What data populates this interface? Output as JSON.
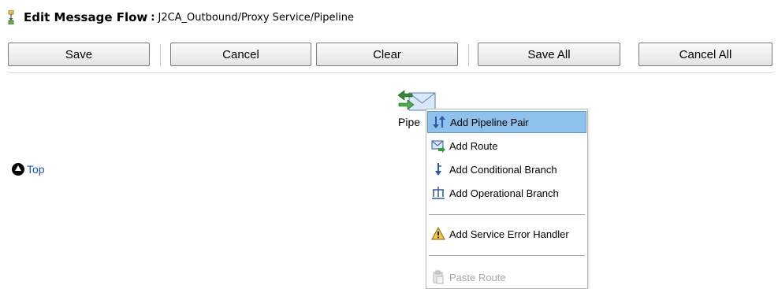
{
  "header": {
    "title": "Edit Message Flow",
    "separator": ":",
    "path": "J2CA_Outbound/Proxy Service/Pipeline"
  },
  "toolbar": {
    "save_label": "Save",
    "cancel_label": "Cancel",
    "clear_label": "Clear",
    "save_all_label": "Save All",
    "cancel_all_label": "Cancel All"
  },
  "flow": {
    "node_label": "Pipe",
    "node_icon": "pipeline-envelope-icon"
  },
  "nav": {
    "top_label": "Top",
    "top_icon": "up-arrow-circle-icon"
  },
  "context_menu": {
    "items": [
      {
        "label": "Add Pipeline Pair",
        "icon": "pipeline-pair-icon",
        "highlighted": true
      },
      {
        "label": "Add Route",
        "icon": "route-icon"
      },
      {
        "label": "Add Conditional Branch",
        "icon": "conditional-branch-icon"
      },
      {
        "label": "Add Operational Branch",
        "icon": "operational-branch-icon"
      },
      {
        "label": "Add Service Error Handler",
        "icon": "warning-icon"
      },
      {
        "label": "Paste Route",
        "icon": "paste-icon",
        "disabled": true
      }
    ]
  },
  "colors": {
    "highlight": "#8ec1ec",
    "link": "#1a4fc9",
    "disabled_text": "#a8a8a8"
  }
}
